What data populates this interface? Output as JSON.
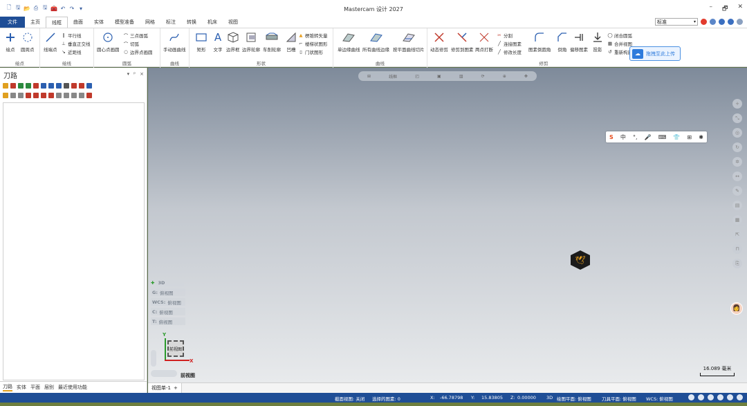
{
  "app": {
    "title": "Mastercam 设计 2027"
  },
  "window_controls": {
    "minimize": "–",
    "restore": "🗗",
    "close": "✕"
  },
  "quick_access": {
    "icons": [
      "new-file-icon",
      "save-icon",
      "open-folder-icon",
      "print-icon",
      "save-as-icon",
      "toolbox-icon",
      "undo-icon",
      "redo-icon"
    ]
  },
  "tabs": [
    {
      "label": "文件"
    },
    {
      "label": "主页"
    },
    {
      "label": "线框"
    },
    {
      "label": "曲面"
    },
    {
      "label": "实体"
    },
    {
      "label": "模型准备"
    },
    {
      "label": "网格"
    },
    {
      "label": "标注"
    },
    {
      "label": "转换"
    },
    {
      "label": "机床"
    },
    {
      "label": "视图"
    }
  ],
  "right_controls": {
    "combo_value": "标准"
  },
  "ribbon": {
    "groups": {
      "points": {
        "label": "绘点",
        "buttons": [
          "绘点",
          "圆周点"
        ]
      },
      "lines": {
        "label": "绘线",
        "buttons": [
          "线端点"
        ],
        "small": [
          "平行线",
          "垂直正交线",
          "近距线"
        ]
      },
      "arcs": {
        "label": "圆弧",
        "buttons": [
          "圆心点画圆"
        ],
        "small": [
          "三点画弧",
          "切弧",
          "边界点画圆"
        ]
      },
      "curves": {
        "label": "曲线",
        "buttons": [
          "手动画曲线"
        ]
      },
      "shapes": {
        "label": "形状",
        "buttons": [
          "矩形",
          "文字",
          "边界框",
          "边界轮廓",
          "车削轮廓",
          "凹槽"
        ],
        "small": [
          "楞锥转矢量",
          "楼梯状图形",
          "门状图形"
        ]
      },
      "surf_curves": {
        "label": "曲线",
        "buttons": [
          "单边缘曲线",
          "所有曲线边缘",
          "按平面曲线切片"
        ]
      },
      "modify": {
        "label": "修剪",
        "buttons": [
          "动态修剪",
          "修剪到图素",
          "两点打断"
        ],
        "small": [
          "分割",
          "连接图素",
          "修改长度"
        ],
        "buttons2": [
          "图素倒圆角",
          "倒角",
          "偏移图素",
          "投影"
        ],
        "small2": [
          "闭合圆弧",
          "合并视图",
          "重新构建"
        ]
      }
    }
  },
  "upload_popup": {
    "text": "拖拽至此上传"
  },
  "left_panel": {
    "title": "刀路",
    "tabs": [
      "刀路",
      "实体",
      "平面",
      "层别",
      "最近使用功能"
    ]
  },
  "viewport": {
    "toolbar_text": "线框",
    "planes": [
      {
        "key": "3D",
        "value": ""
      },
      {
        "key": "G:",
        "value": "俯视图"
      },
      {
        "key": "WCS:",
        "value": "俯视图"
      },
      {
        "key": "C:",
        "value": "俯视图"
      },
      {
        "key": "T:",
        "value": "俯视图"
      }
    ],
    "view_cube_label": "前视图",
    "view_name": "前视图",
    "axis_y": "Y",
    "axis_x": "X",
    "scale_value": "16.089 毫米",
    "sogou_items": [
      "S",
      "中",
      "°,",
      "🎤",
      "⌨",
      "👕",
      "⊞",
      "✱"
    ]
  },
  "sheet_tabs": [
    {
      "label": "视图单-1"
    }
  ],
  "status": {
    "section_view": "截面视图: 关闭",
    "selected": "选择的图素: 0",
    "x_label": "X:",
    "x_value": "-66.78798",
    "y_label": "Y:",
    "y_value": "15.83805",
    "z_label": "Z:",
    "z_value": "0.00000",
    "mode": "3D",
    "draw_plane": "绘图平面: 俯视图",
    "tool_plane": "刀具平面: 俯视图",
    "wcs": "WCS: 俯视图"
  }
}
